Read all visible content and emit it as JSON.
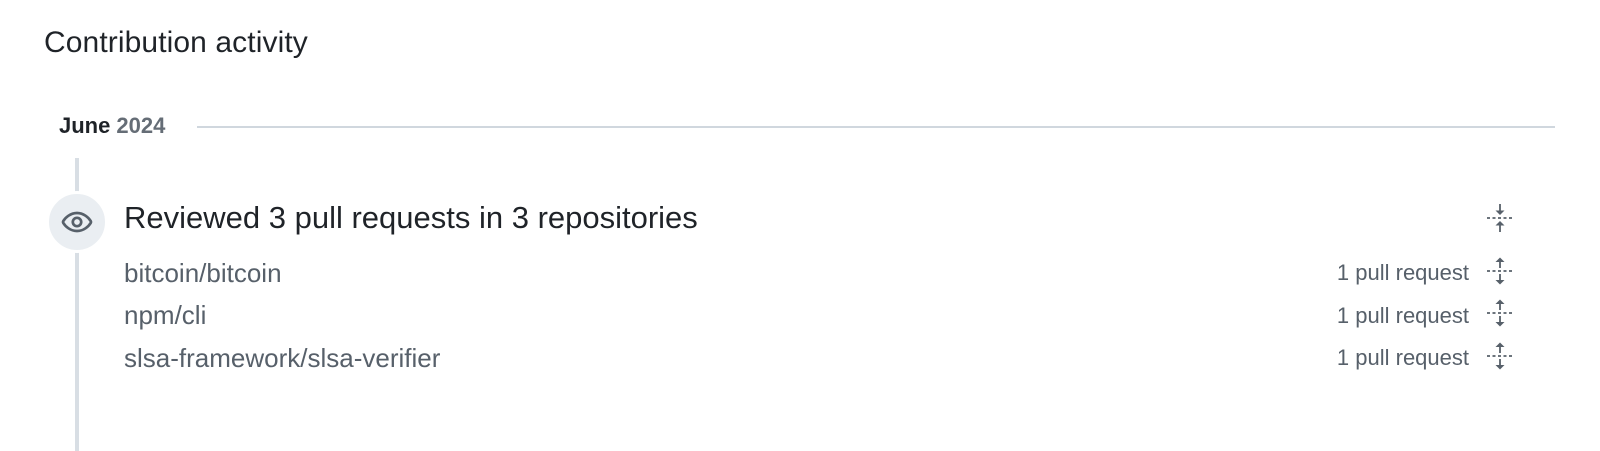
{
  "section": {
    "title": "Contribution activity"
  },
  "month": {
    "name": "June",
    "year": "2024"
  },
  "event": {
    "icon": "eye-icon",
    "title": "Reviewed 3 pull requests in 3 repositories",
    "collapse_icon": "fold-icon",
    "repos": [
      {
        "name": "bitcoin/bitcoin",
        "count": "1 pull request",
        "expand_icon": "unfold-icon"
      },
      {
        "name": "npm/cli",
        "count": "1 pull request",
        "expand_icon": "unfold-icon"
      },
      {
        "name": "slsa-framework/slsa-verifier",
        "count": "1 pull request",
        "expand_icon": "unfold-icon"
      }
    ]
  },
  "colors": {
    "text_primary": "#1f2328",
    "text_muted": "#656d76",
    "link_muted": "#57606a",
    "timeline": "#d8dee4",
    "badge_bg": "#eaeef2",
    "rule": "#d0d7de"
  }
}
